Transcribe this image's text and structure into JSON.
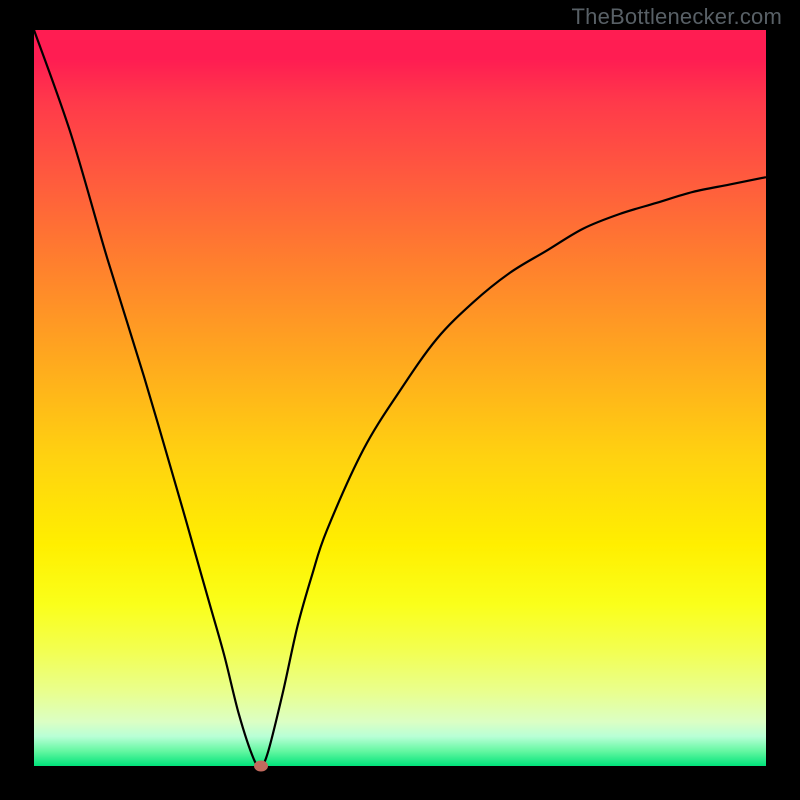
{
  "watermark": "TheBottlenecker.com",
  "colors": {
    "background": "#000000",
    "curve": "#000000",
    "dot": "#c26a5e",
    "watermark": "#586066"
  },
  "chart_data": {
    "type": "line",
    "title": "",
    "xlabel": "",
    "ylabel": "",
    "xlim": [
      0,
      100
    ],
    "ylim": [
      0,
      100
    ],
    "x": [
      0,
      5,
      10,
      15,
      20,
      22,
      24,
      26,
      28,
      30,
      31,
      32,
      34,
      36,
      38,
      40,
      45,
      50,
      55,
      60,
      65,
      70,
      75,
      80,
      85,
      90,
      95,
      100
    ],
    "values": [
      100,
      86,
      69,
      53,
      36,
      29,
      22,
      15,
      7,
      1,
      0,
      2,
      10,
      19,
      26,
      32,
      43,
      51,
      58,
      63,
      67,
      70,
      73,
      75,
      76.5,
      78,
      79,
      80
    ],
    "minimum": {
      "x": 31,
      "y": 0
    },
    "annotations": []
  }
}
